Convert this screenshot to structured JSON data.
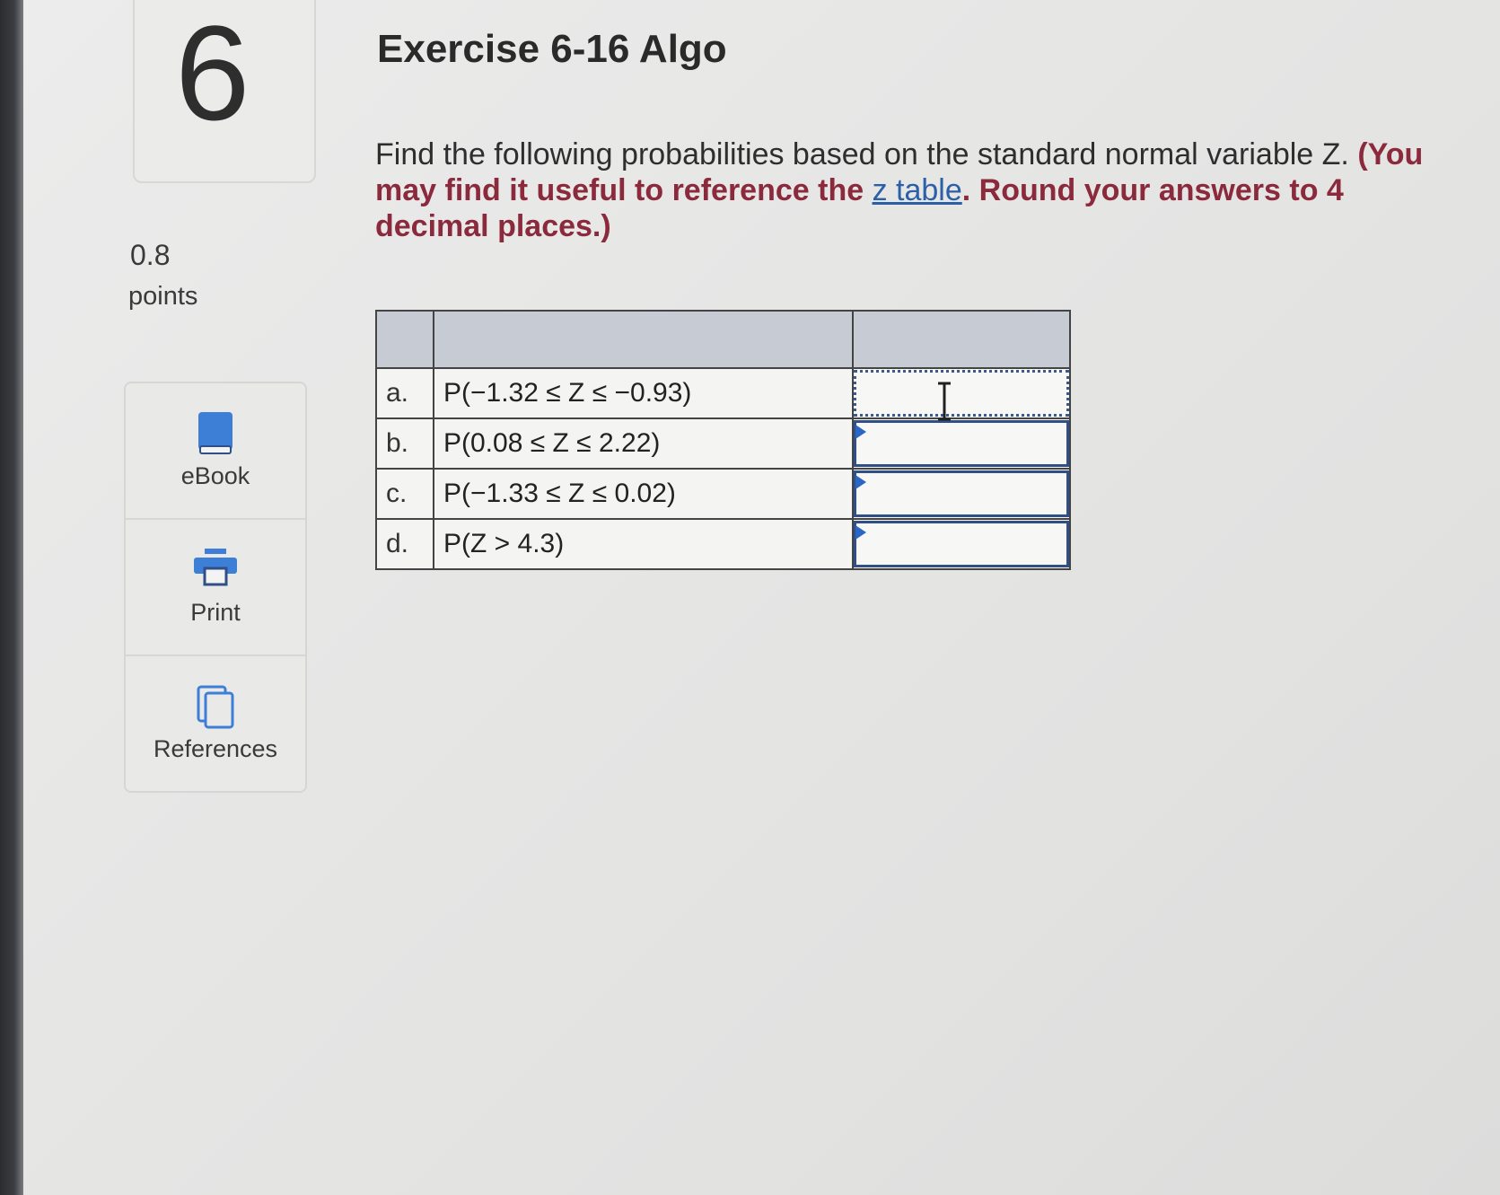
{
  "question": {
    "number": "6",
    "points_value": "0.8",
    "points_label": "points",
    "title": "Exercise 6-16 Algo"
  },
  "tools": [
    {
      "label": "eBook",
      "icon": "book-icon"
    },
    {
      "label": "Print",
      "icon": "printer-icon"
    },
    {
      "label": "References",
      "icon": "copy-icon"
    }
  ],
  "prompt": {
    "plain": "Find the following probabilities based on the standard normal variable Z.",
    "emph_start": "(You may find it useful to reference the ",
    "link": "z table",
    "emph_end": ". Round your answers to 4 decimal places.)"
  },
  "rows": [
    {
      "letter": "a.",
      "expr": "P(−1.32 ≤ Z ≤ −0.93)",
      "value": ""
    },
    {
      "letter": "b.",
      "expr": "P(0.08 ≤ Z ≤ 2.22)",
      "value": ""
    },
    {
      "letter": "c.",
      "expr": "P(−1.33 ≤ Z ≤ 0.02)",
      "value": ""
    },
    {
      "letter": "d.",
      "expr": "P(Z > 4.3)",
      "value": ""
    }
  ],
  "colors": {
    "accent": "#2f4f86",
    "emphasis": "#8b2a3c",
    "link": "#2b5fa8",
    "header": "#c6cbd4"
  }
}
